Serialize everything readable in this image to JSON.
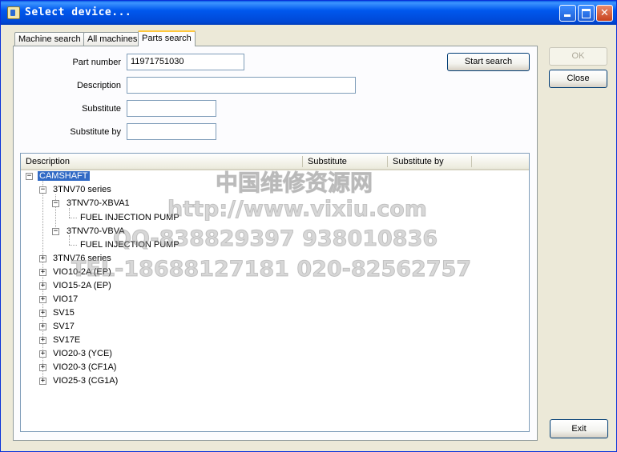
{
  "window": {
    "title": "Select device...",
    "controls": [
      "minimize-icon",
      "maximize-icon",
      "close-icon"
    ]
  },
  "tabs": [
    {
      "label": "Machine search",
      "active": false
    },
    {
      "label": "All machines",
      "active": false
    },
    {
      "label": "Parts search",
      "active": true
    }
  ],
  "form": {
    "part_number_label": "Part number",
    "part_number_value": "11971751030",
    "description_label": "Description",
    "description_value": "",
    "substitute_label": "Substitute",
    "substitute_value": "",
    "substitute_by_label": "Substitute by",
    "substitute_by_value": "",
    "start_search_label": "Start search"
  },
  "side_buttons": {
    "ok_label": "OK",
    "close_label": "Close",
    "exit_label": "Exit"
  },
  "tree": {
    "columns": [
      "Description",
      "Substitute",
      "Substitute by"
    ],
    "root": "CAMSHAFT",
    "series_open": "3TNV70 series",
    "models": [
      "3TNV70-XBVA1",
      "3TNV70-VBVA"
    ],
    "part": "FUEL INJECTION PUMP",
    "other_series": [
      "3TNV76 series",
      "VIO10-2A (EP)",
      "VIO15-2A (EP)",
      "VIO17",
      "SV15",
      "SV17",
      "SV17E",
      "VIO20-3 (YCE)",
      "VIO20-3 (CF1A)",
      "VIO25-3 (CG1A)"
    ]
  },
  "watermark": {
    "line1": "中国维修资源网",
    "line2": "http://www.vixiu.com",
    "line3": "QQ-838829397 938010836",
    "line4": "TEL-18688127181 020-82562757"
  }
}
